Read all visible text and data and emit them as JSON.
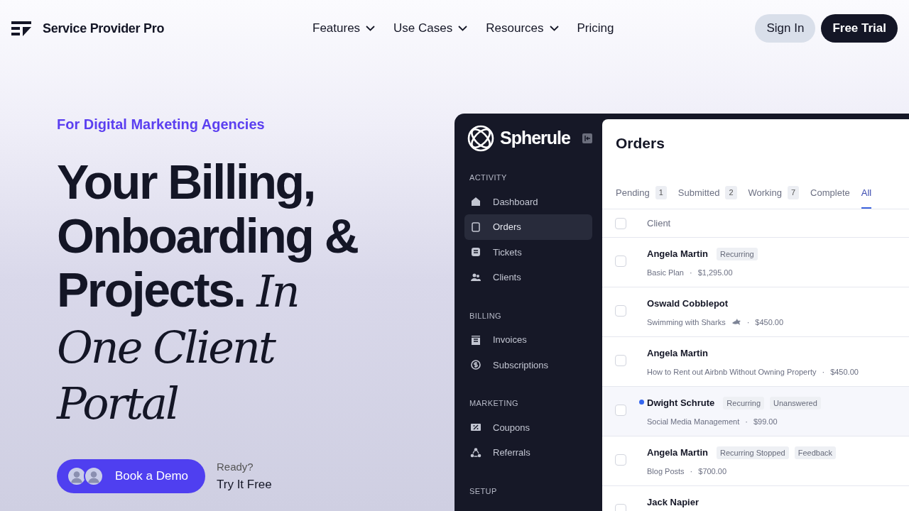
{
  "header": {
    "brand": "Service Provider Pro",
    "nav": [
      {
        "label": "Features",
        "dropdown": true
      },
      {
        "label": "Use Cases",
        "dropdown": true
      },
      {
        "label": "Resources",
        "dropdown": true
      },
      {
        "label": "Pricing",
        "dropdown": false
      }
    ],
    "sign_in": "Sign In",
    "free_trial": "Free Trial"
  },
  "hero": {
    "eyebrow": "For Digital Marketing Agencies",
    "headline": "Your Billing, Onboarding & Projects. *In One Client Portal*",
    "demo_button": "Book a Demo",
    "ready": "Ready?",
    "try_free": "Try It Free"
  },
  "app": {
    "brand": "Spherule",
    "sidebar": [
      {
        "heading": "ACTIVITY",
        "items": [
          {
            "label": "Dashboard",
            "selected": false
          },
          {
            "label": "Orders",
            "selected": true
          },
          {
            "label": "Tickets",
            "selected": false
          },
          {
            "label": "Clients",
            "selected": false
          }
        ]
      },
      {
        "heading": "BILLING",
        "items": [
          {
            "label": "Invoices",
            "selected": false
          },
          {
            "label": "Subscriptions",
            "selected": false
          }
        ]
      },
      {
        "heading": "MARKETING",
        "items": [
          {
            "label": "Coupons",
            "selected": false
          },
          {
            "label": "Referrals",
            "selected": false
          }
        ]
      },
      {
        "heading": "SETUP"
      }
    ],
    "title": "Orders",
    "tabs": [
      {
        "label": "Pending",
        "count": "1",
        "selected": false
      },
      {
        "label": "Submitted",
        "count": "2",
        "selected": false
      },
      {
        "label": "Working",
        "count": "7",
        "selected": false
      },
      {
        "label": "Complete",
        "selected": false
      },
      {
        "label": "All",
        "selected": true
      }
    ],
    "table": {
      "column": "Client",
      "select_all_checked": false,
      "rows": [
        {
          "checked": false,
          "name": "Angela Martin",
          "tags": [
            "Recurring"
          ],
          "unread": false,
          "service": "Basic Plan",
          "service_icon": false,
          "separator": "·",
          "price": "$1,295.00"
        },
        {
          "checked": false,
          "name": "Oswald Cobblepot",
          "tags": [],
          "unread": false,
          "service": "Swimming with Sharks",
          "service_icon": true,
          "separator": "·",
          "price": "$450.00"
        },
        {
          "checked": false,
          "name": "Angela Martin",
          "tags": [],
          "unread": false,
          "service": "How to Rent out Airbnb Without Owning Property",
          "service_icon": false,
          "separator": "·",
          "price": "$450.00"
        },
        {
          "checked": false,
          "name": "Dwight Schrute",
          "tags": [
            "Recurring",
            "Unanswered"
          ],
          "unread": true,
          "service": "Social Media Management",
          "service_icon": false,
          "separator": "·",
          "price": "$99.00"
        },
        {
          "checked": false,
          "name": "Angela Martin",
          "tags": [
            "Recurring Stopped",
            "Feedback"
          ],
          "unread": false,
          "service": "Blog Posts",
          "service_icon": false,
          "separator": "·",
          "price": "$700.00"
        },
        {
          "name": "Jack Napier",
          "tags": [],
          "unread": false
        }
      ]
    }
  }
}
